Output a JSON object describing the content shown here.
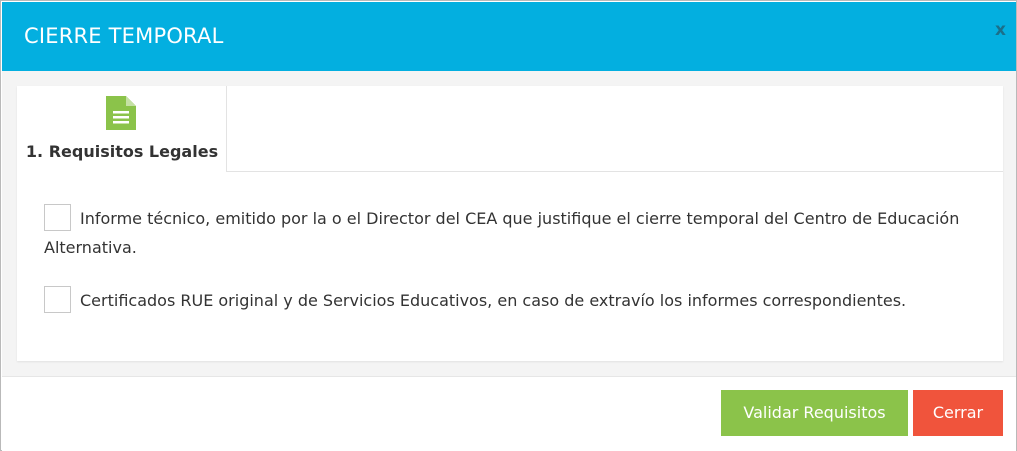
{
  "modal": {
    "title": "CIERRE TEMPORAL",
    "close_label": "x"
  },
  "tabs": [
    {
      "label": "1. Requisitos Legales",
      "icon": "document-icon"
    }
  ],
  "requirements": [
    {
      "text": "Informe técnico, emitido por la o el Director del CEA que justifique el cierre temporal del Centro de Educación Alternativa.",
      "checked": false
    },
    {
      "text": "Certificados RUE original y de Servicios Educativos, en caso de extravío los informes correspondientes.",
      "checked": false
    }
  ],
  "footer": {
    "validate_label": "Validar Requisitos",
    "close_label": "Cerrar"
  },
  "colors": {
    "header_bg": "#03afe0",
    "tab_icon": "#8bc34a",
    "validate_button": "#8bc34a",
    "close_button": "#f0543c"
  }
}
